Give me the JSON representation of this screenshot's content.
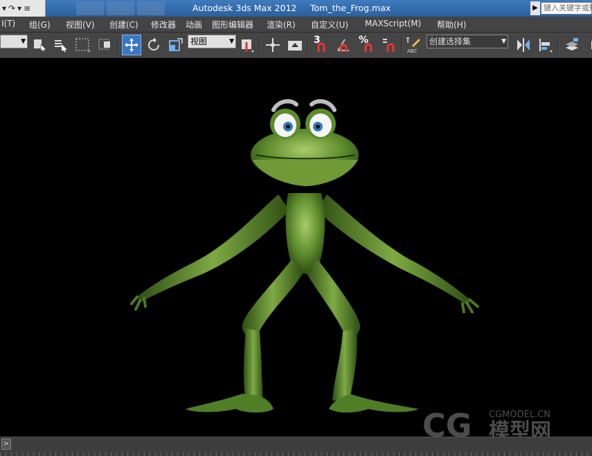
{
  "titlebar": {
    "app_title": "Autodesk 3ds Max  2012",
    "file_name": "Tom_the_Frog.max",
    "search_placeholder": "键入关键字或短语",
    "quick_access": [
      "redo-icon",
      "dropdown-arrow-icon",
      "customize-icon"
    ]
  },
  "menubar": {
    "items": [
      {
        "label": "I(T)"
      },
      {
        "label": "组(G)"
      },
      {
        "label": "视图(V)"
      },
      {
        "label": "创建(C)"
      },
      {
        "label": "修改器"
      },
      {
        "label": "动画"
      },
      {
        "label": "图形编辑器"
      },
      {
        "label": "渲染(R)"
      },
      {
        "label": "自定义(U)"
      },
      {
        "label": "MAXScript(M)"
      },
      {
        "label": "帮助(H)"
      }
    ]
  },
  "toolbar": {
    "selection_filter_value": "",
    "reference_coord": "视图",
    "named_selection": "创建选择集",
    "snap_label": "3",
    "percent_label": "%"
  },
  "watermark": {
    "text": "CGMODEL.CN",
    "logo_text": "模型网"
  },
  "statusbar": {
    "text": ""
  },
  "colors": {
    "titlebar": "#2a5f9c",
    "toolbar": "#454545",
    "viewport": "#000000",
    "frog_green": "#5a8a2e",
    "active_tool": "#3a77c5"
  }
}
